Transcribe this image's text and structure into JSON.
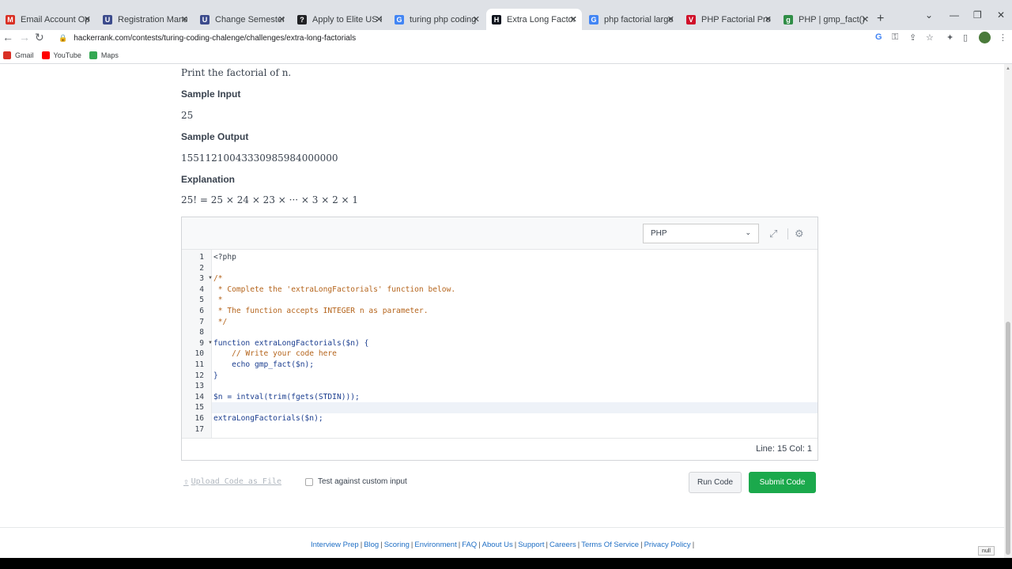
{
  "browser": {
    "tabs": [
      {
        "label": "Email Account Open F",
        "color": "#d93025",
        "glyph": "M",
        "active": false
      },
      {
        "label": "Registration Manager",
        "color": "#3c4b8c",
        "glyph": "U",
        "active": false
      },
      {
        "label": "Change Semester",
        "color": "#3c4b8c",
        "glyph": "U",
        "active": false
      },
      {
        "label": "Apply to Elite US Rem",
        "color": "#202124",
        "glyph": "?",
        "active": false
      },
      {
        "label": "turing php coding cha",
        "color": "#4285f4",
        "glyph": "G",
        "active": false
      },
      {
        "label": "Extra Long Factorials |",
        "color": "#0e141e",
        "glyph": "H",
        "active": true
      },
      {
        "label": "php factorial largest c",
        "color": "#4285f4",
        "glyph": "G",
        "active": false
      },
      {
        "label": "PHP Factorial Program",
        "color": "#d0102a",
        "glyph": "V",
        "active": false
      },
      {
        "label": "PHP | gmp_fact() for la",
        "color": "#2f8d46",
        "glyph": "g",
        "active": false
      }
    ],
    "url": "hackerrank.com/contests/turing-coding-chalenge/challenges/extra-long-factorials",
    "bookmarks": [
      {
        "label": "Gmail",
        "color": "#d93025"
      },
      {
        "label": "YouTube",
        "color": "#ff0000"
      },
      {
        "label": "Maps",
        "color": "#34a853"
      }
    ]
  },
  "problem": {
    "print_line": "Print the factorial of n.",
    "sample_input_heading": "Sample Input",
    "sample_input": "25",
    "sample_output_heading": "Sample Output",
    "sample_output": "15511210043330985984000000",
    "explanation_heading": "Explanation",
    "explanation": "25! = 25 × 24 × 23 × ··· × 3 × 2 × 1"
  },
  "editor": {
    "language": "PHP",
    "code_lines": [
      "<?php",
      "",
      "/*",
      " * Complete the 'extraLongFactorials' function below.",
      " *",
      " * The function accepts INTEGER n as parameter.",
      " */",
      "",
      "function extraLongFactorials($n) {",
      "    // Write your code here",
      "    echo gmp_fact($n);",
      "}",
      "",
      "$n = intval(trim(fgets(STDIN)));",
      "",
      "extraLongFactorials($n);",
      ""
    ],
    "current_line": 15,
    "cursor_position": "Line: 15 Col: 1"
  },
  "actions": {
    "upload_label": "Upload Code as File",
    "custom_input_label": "Test against custom input",
    "run_label": "Run Code",
    "submit_label": "Submit Code"
  },
  "footer": {
    "links": [
      "Interview Prep",
      "Blog",
      "Scoring",
      "Environment",
      "FAQ",
      "About Us",
      "Support",
      "Careers",
      "Terms Of Service",
      "Privacy Policy"
    ]
  },
  "badge": "null",
  "colors": {
    "submit_green": "#1ba94c",
    "link_blue": "#1f6fc5",
    "comment_orange": "#b5651d",
    "keyword_blue": "#1a3d8f"
  }
}
